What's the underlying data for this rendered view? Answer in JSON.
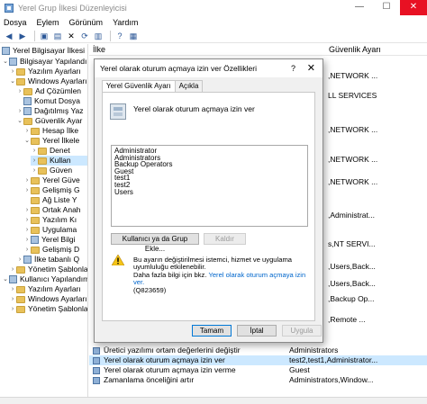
{
  "window": {
    "title": "Yerel Grup İlkesi Düzenleyicisi",
    "minimize": "—",
    "maximize": "☐",
    "close": "✕"
  },
  "menu": [
    "Dosya",
    "Eylem",
    "Görünüm",
    "Yardım"
  ],
  "tree": [
    {
      "label": "Yerel Bilgisayar İlkesi",
      "level": 0
    },
    {
      "label": "Bilgisayar Yapılandırma",
      "level": 1
    },
    {
      "label": "Yazılım Ayarları",
      "level": 2
    },
    {
      "label": "Windows Ayarları",
      "level": 2
    },
    {
      "label": "Ad Çözümlen",
      "level": 3
    },
    {
      "label": "Komut Dosya",
      "level": 3
    },
    {
      "label": "Dağıtılmış Yaz",
      "level": 3
    },
    {
      "label": "Güvenlik Ayar",
      "level": 3
    },
    {
      "label": "Hesap İlke",
      "level": 4
    },
    {
      "label": "Yerel İlkele",
      "level": 4
    },
    {
      "label": "Denet",
      "level": 5
    },
    {
      "label": "Kullan",
      "level": 5
    },
    {
      "label": "Güven",
      "level": 5
    },
    {
      "label": "Yerel Güve",
      "level": 4
    },
    {
      "label": "Gelişmiş G",
      "level": 4
    },
    {
      "label": "Ağ Liste Y",
      "level": 4
    },
    {
      "label": "Ortak Anah",
      "level": 4
    },
    {
      "label": "Yazılım Kı",
      "level": 4
    },
    {
      "label": "Uygulama",
      "level": 4
    },
    {
      "label": "Yerel Bilgi",
      "level": 4
    },
    {
      "label": "Gelişmiş D",
      "level": 4
    },
    {
      "label": "İlke tabanlı Q",
      "level": 3
    },
    {
      "label": "Yönetim Şablonları",
      "level": 2
    },
    {
      "label": "Kullanıcı Yapılandırm",
      "level": 1
    },
    {
      "label": "Yazılım Ayarları",
      "level": 2
    },
    {
      "label": "Windows Ayarları",
      "level": 2
    },
    {
      "label": "Yönetim Şablonları",
      "level": 2
    }
  ],
  "list": {
    "col_policy": "İlke",
    "col_setting": "Güvenlik Ayarı",
    "right_values": [
      ",NETWORK ...",
      "LL SERVICES",
      ",NETWORK ...",
      ",NETWORK ...",
      ",NETWORK ...",
      ",Administrat...",
      "s,NT SERVI...",
      ",Users,Back...",
      ",Users,Back...",
      ",Backup Op...",
      ",Remote ..."
    ],
    "bottom_rows": [
      {
        "policy": "Üretici yazılımı ortam değerlerini değiştir",
        "setting": "Administrators",
        "selected": false
      },
      {
        "policy": "Yerel olarak oturum açmaya izin ver",
        "setting": "test2,test1,Administrator...",
        "selected": true
      },
      {
        "policy": "Yerel olarak oturum açmaya izin verme",
        "setting": "Guest",
        "selected": false
      },
      {
        "policy": "Zamanlama önceliğini artır",
        "setting": "Administrators,Window...",
        "selected": false
      }
    ]
  },
  "dialog": {
    "title": "Yerel olarak oturum açmaya izin ver Özellikleri",
    "help": "?",
    "close": "✕",
    "tabs": [
      "Yerel Güvenlik Ayarı",
      "Açıkla"
    ],
    "policy_name": "Yerel olarak oturum açmaya izin ver",
    "users": [
      "Administrator",
      "Administrators",
      "Backup Operators",
      "Guest",
      "test1",
      "test2",
      "Users"
    ],
    "add_button": "Kullanıcı ya da Grup Ekle...",
    "remove_button": "Kaldır",
    "warning_line1": "Bu ayarın değiştirilmesi istemci, hizmet ve uygulama uyumluluğu etkilenebilir.",
    "warning_line2": "Daha fazla bilgi için bkz.",
    "warning_link": "Yerel olarak oturum açmaya izin ver.",
    "warning_kb": "(Q823659)",
    "ok": "Tamam",
    "cancel": "İptal",
    "apply": "Uygula"
  }
}
